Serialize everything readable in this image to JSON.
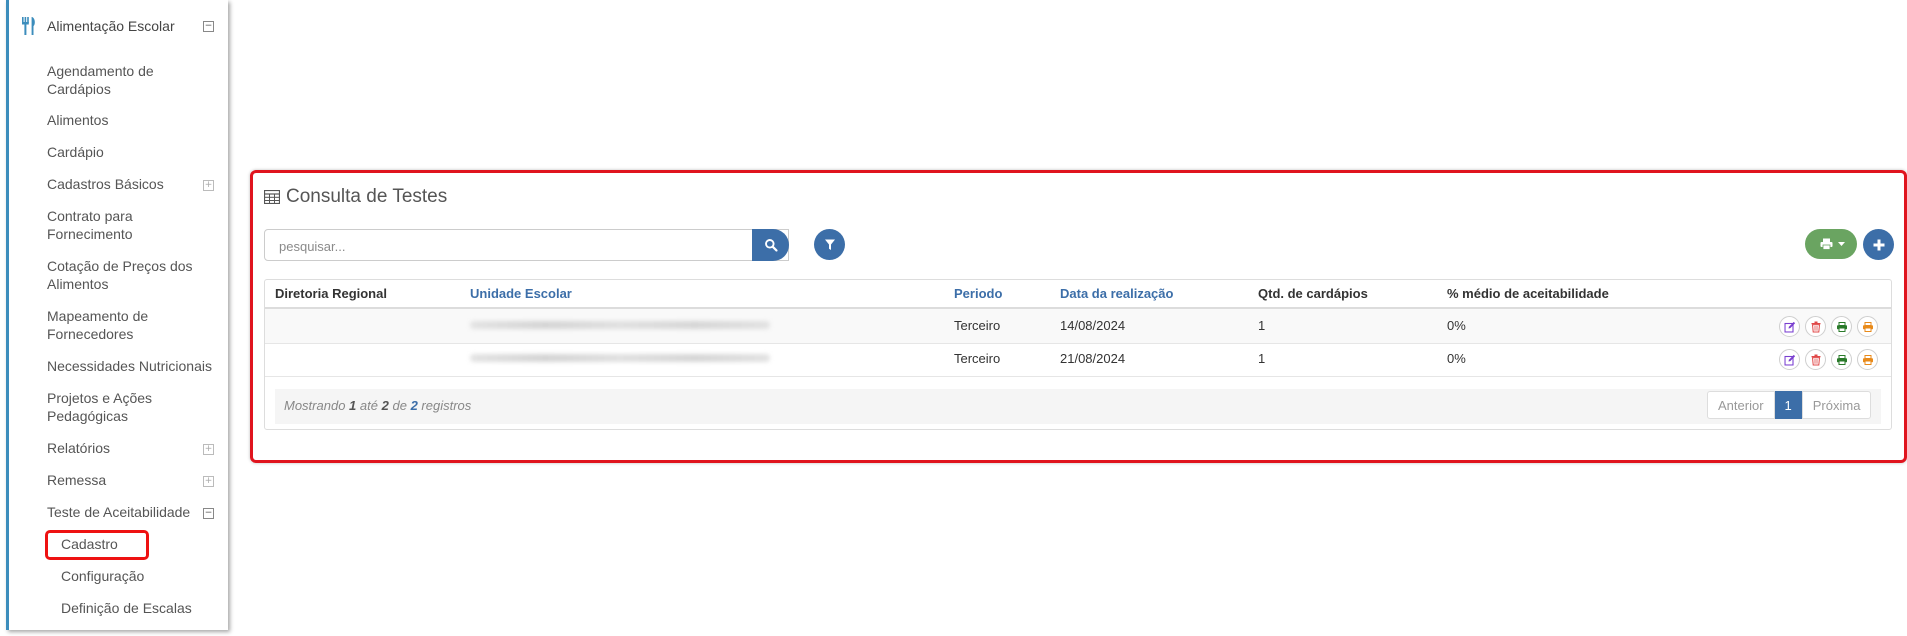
{
  "sidebar": {
    "header": "Alimentação Escolar",
    "items": [
      {
        "label": "Agendamento de Cardápios"
      },
      {
        "label": "Alimentos"
      },
      {
        "label": "Cardápio"
      },
      {
        "label": "Cadastros Básicos"
      },
      {
        "label": "Contrato para Fornecimento"
      },
      {
        "label": "Cotação de Preços dos Alimentos"
      },
      {
        "label": "Mapeamento de Fornecedores"
      },
      {
        "label": "Necessidades Nutricionais"
      },
      {
        "label": "Projetos e Ações Pedagógicas"
      },
      {
        "label": "Relatórios"
      },
      {
        "label": "Remessa"
      },
      {
        "label": "Teste de Aceitabilidade"
      }
    ],
    "subitems": [
      {
        "label": "Cadastro"
      },
      {
        "label": "Configuração"
      },
      {
        "label": "Definição de Escalas"
      }
    ]
  },
  "main": {
    "title": "Consulta de Testes",
    "search_placeholder": "pesquisar...",
    "columns": [
      "Diretoria Regional",
      "Unidade Escolar",
      "Periodo",
      "Data da realização",
      "Qtd. de cardápios",
      "% médio de aceitabilidade"
    ],
    "rows": [
      {
        "diretoria": "",
        "periodo": "Terceiro",
        "data": "14/08/2024",
        "qtd": "1",
        "media": "0%"
      },
      {
        "diretoria": "",
        "periodo": "Terceiro",
        "data": "21/08/2024",
        "qtd": "1",
        "media": "0%"
      }
    ],
    "footer": {
      "prefix": "Mostrando",
      "from": "1",
      "mid1": "até",
      "to": "2",
      "mid2": "de",
      "total": "2",
      "suffix": "registros"
    },
    "pagination": {
      "prev": "Anterior",
      "current": "1",
      "next": "Próxima"
    }
  },
  "colors": {
    "primary": "#3c6ea8",
    "print_green": "#6aa461",
    "highlight_red": "#e0141e",
    "sidebar_accent": "#3c8dbc"
  },
  "icons": {
    "header": "fork-knife-icon",
    "title": "table-icon",
    "search": "search-icon",
    "filter": "filter-icon",
    "print": "print-icon",
    "add": "plus-icon",
    "row_actions": [
      "edit-icon",
      "trash-icon",
      "print-icon",
      "print-icon"
    ]
  }
}
